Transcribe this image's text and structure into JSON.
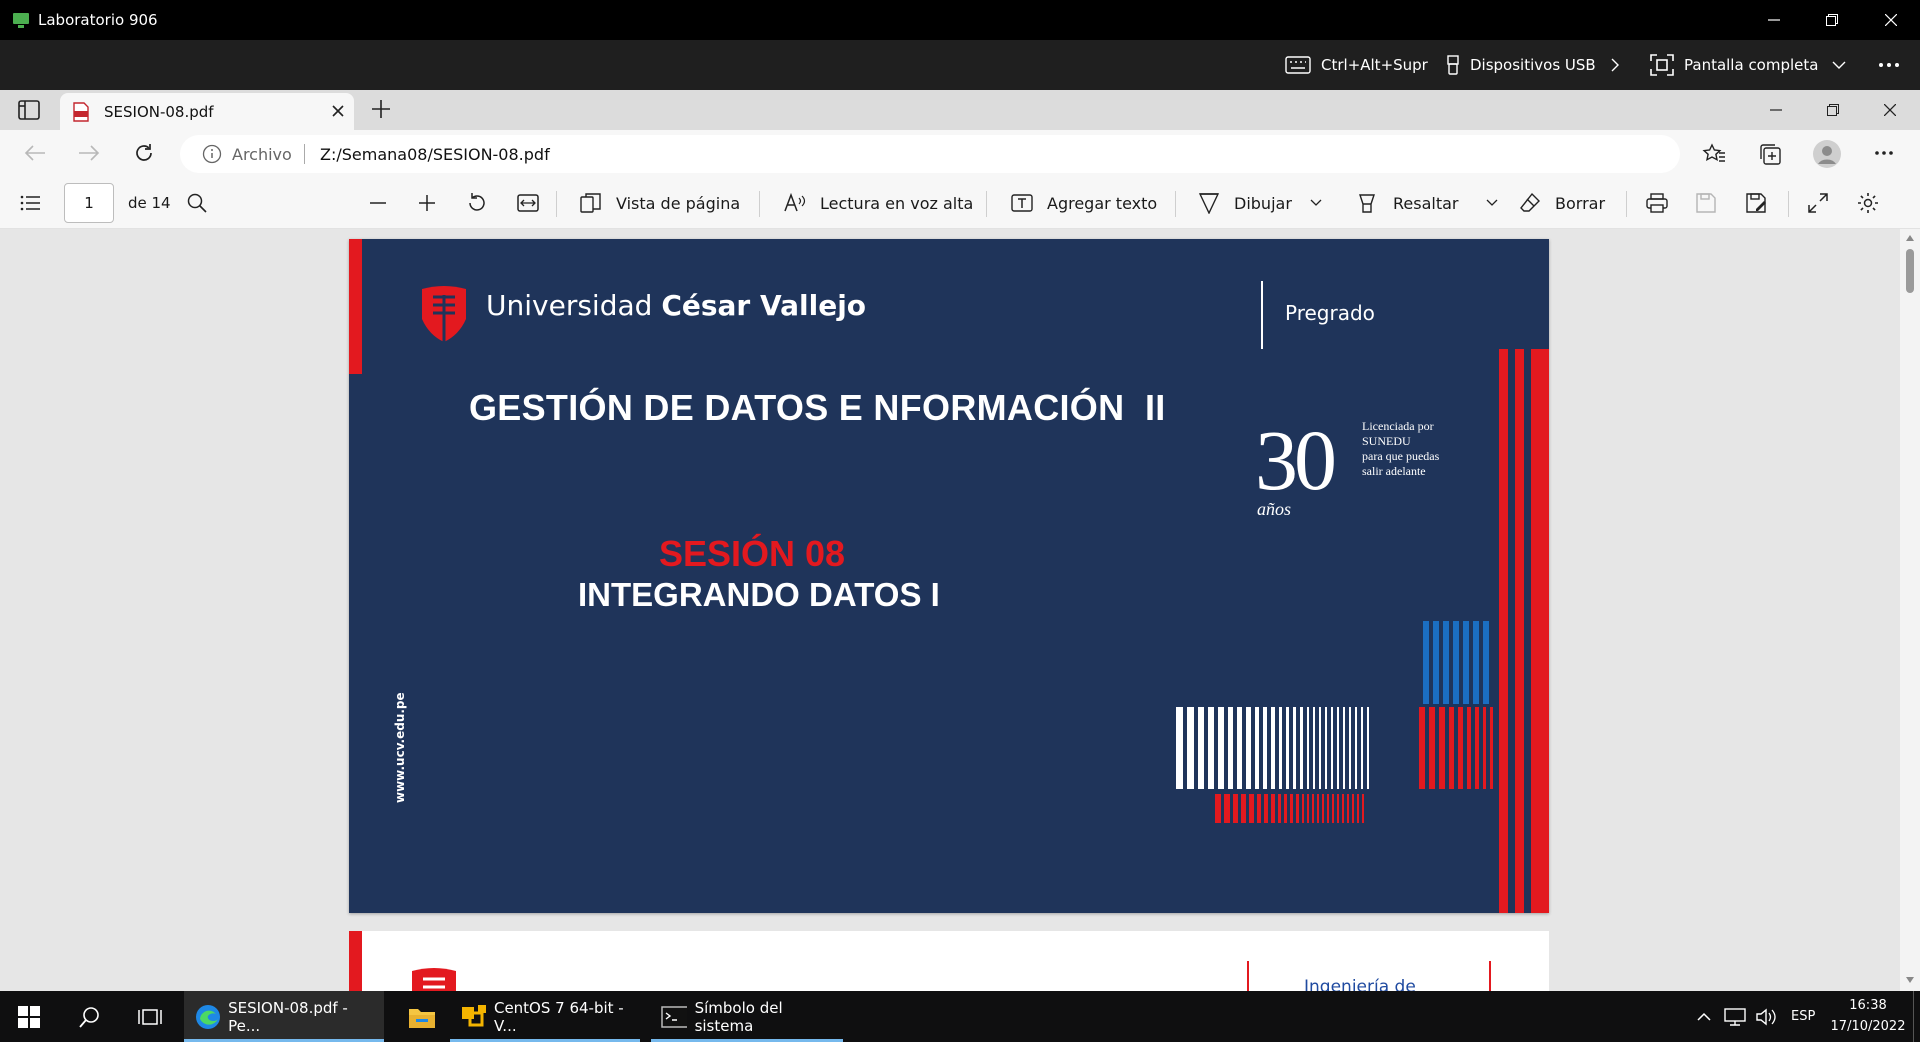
{
  "window": {
    "title": "Laboratorio 906"
  },
  "rdp_bar": {
    "ctrl_alt_del": "Ctrl+Alt+Supr",
    "usb": "Dispositivos USB",
    "fullscreen": "Pantalla completa"
  },
  "browser": {
    "tab_title": "SESION-08.pdf",
    "address_label": "Archivo",
    "address_url": "Z:/Semana08/SESION-08.pdf"
  },
  "pdf_toolbar": {
    "page_number": "1",
    "page_total": "de 14",
    "page_view": "Vista de página",
    "read_aloud": "Lectura en voz alta",
    "add_text": "Agregar texto",
    "draw": "Dibujar",
    "highlight": "Resaltar",
    "erase": "Borrar"
  },
  "slide": {
    "university_regular": "Universidad ",
    "university_bold": "César Vallejo",
    "level": "Pregrado",
    "course_title": "GESTIÓN DE DATOS E NFORMACIÓN  II",
    "anniversary_number": "30",
    "anniversary_word": "años",
    "license_lines": [
      "Licenciada por",
      "SUNEDU",
      "para que puedas",
      "salir adelante"
    ],
    "session": "SESIÓN 08",
    "topic": "INTEGRANDO DATOS I",
    "website": "www.ucv.edu.pe",
    "colors": {
      "navy": "#1f345a",
      "red": "#e3191f",
      "blue": "#1b6ec2"
    }
  },
  "next_page": {
    "header_text": "Ingeniería de"
  },
  "taskbar": {
    "apps": [
      {
        "label": "SESION-08.pdf - Pe..."
      },
      {
        "label": ""
      },
      {
        "label": "CentOS 7 64-bit - V..."
      },
      {
        "label": "Símbolo del sistema"
      }
    ],
    "language": "ESP",
    "time": "16:38",
    "date": "17/10/2022"
  }
}
